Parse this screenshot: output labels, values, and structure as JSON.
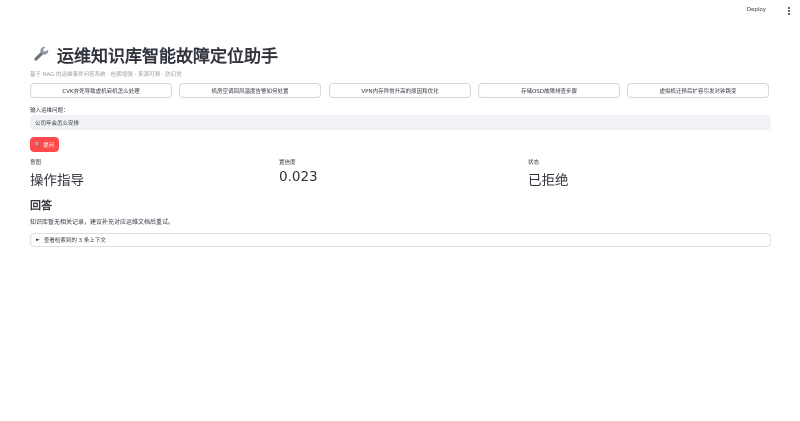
{
  "header": {
    "deploy_label": "Deploy"
  },
  "page": {
    "title": "运维知识库智能故障定位助手",
    "caption": "基于 RAG 的运维事件问答系统 · 检索增强 · 来源可溯 · 防幻觉"
  },
  "examples": [
    "CVK夯死导致虚机宕机怎么处理",
    "机房空调回风温度告警如何处置",
    "VPN内存异常升高的原因和优化",
    "存储OSD故障排查步骤",
    "虚拟机迁移后扩容引发对钟跳变"
  ],
  "query": {
    "label": "输入运维问题：",
    "value": "公司年会怎么安排"
  },
  "ask_button": {
    "icon": "🔍",
    "label": "提问"
  },
  "metrics": [
    {
      "label": "意图",
      "value": "操作指导"
    },
    {
      "label": "置信度",
      "value": "0.023"
    },
    {
      "label": "状态",
      "value": "已拒绝"
    }
  ],
  "answer": {
    "title": "回答",
    "text": "知识库暂无相关记录，建议补充对应运维文档后重试。"
  },
  "expander": {
    "label": "查看检索到的 3 条上下文"
  },
  "colors": {
    "primary": "#ff4b4b",
    "text": "#31333f",
    "muted": "#9a9ca6",
    "input_bg": "#f0f2f6"
  }
}
